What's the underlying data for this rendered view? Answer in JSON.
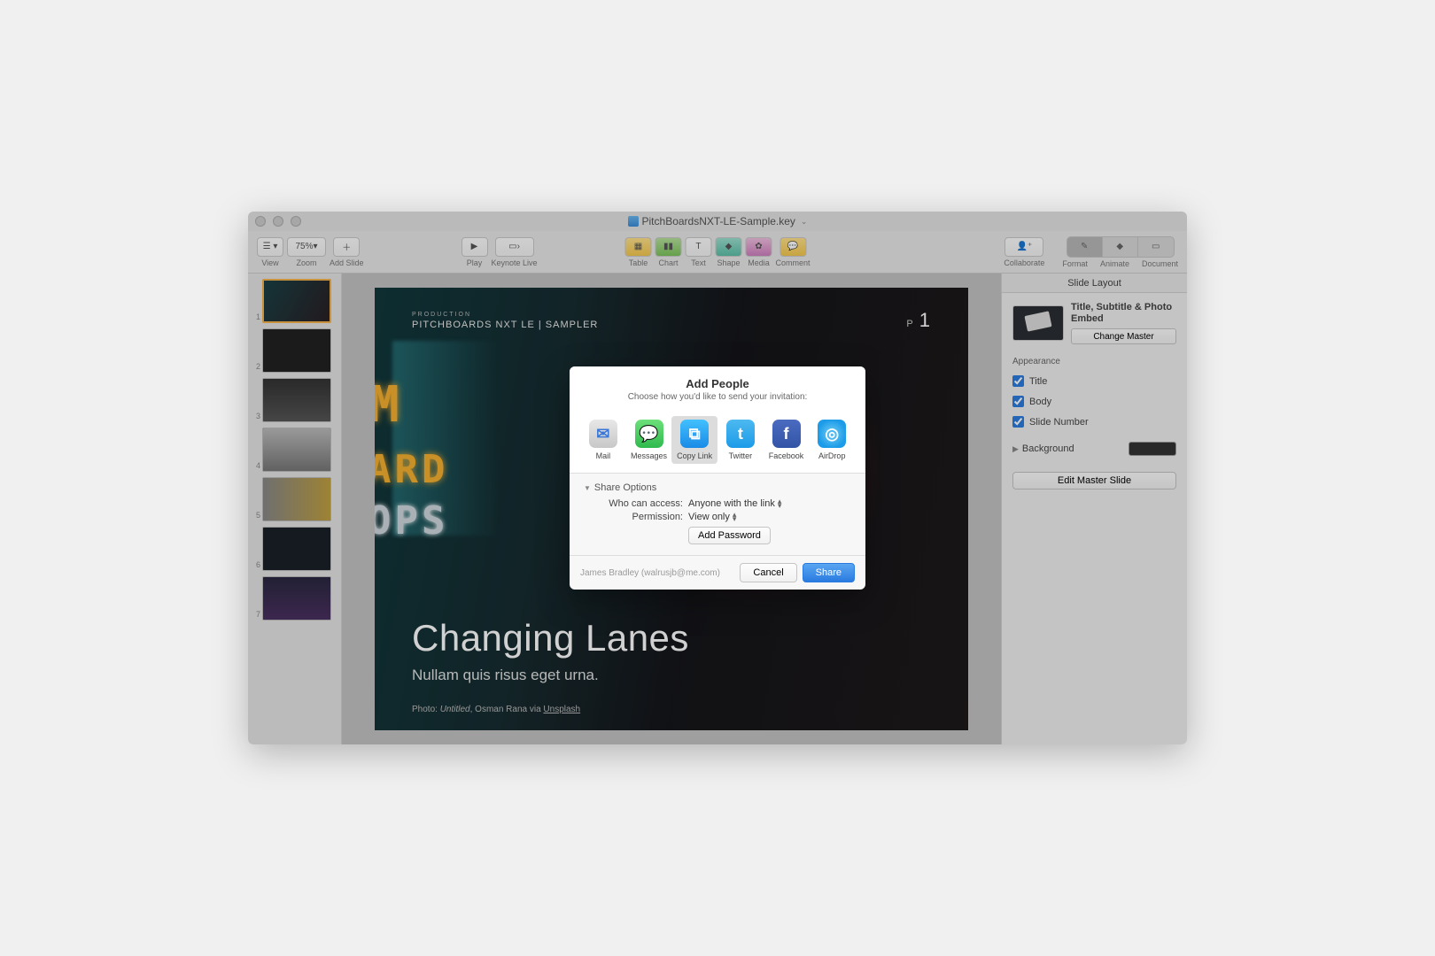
{
  "titlebar": {
    "filename": "PitchBoardsNXT-LE-Sample.key"
  },
  "toolbar": {
    "view": "View",
    "zoom": "Zoom",
    "zoom_value": "75%",
    "add_slide": "Add Slide",
    "play": "Play",
    "keynote_live": "Keynote Live",
    "table": "Table",
    "chart": "Chart",
    "text": "Text",
    "shape": "Shape",
    "media": "Media",
    "comment": "Comment",
    "collaborate": "Collaborate",
    "format": "Format",
    "animate": "Animate",
    "document": "Document"
  },
  "navigator": {
    "slides": [
      {
        "num": "1"
      },
      {
        "num": "2"
      },
      {
        "num": "3"
      },
      {
        "num": "4"
      },
      {
        "num": "5"
      },
      {
        "num": "6"
      },
      {
        "num": "7"
      }
    ]
  },
  "slide": {
    "pre": "PRODUCTION",
    "header": "PITCHBOARDS NXT LE | SAMPLER",
    "page_prefix": "P",
    "page_num": "1",
    "neon1": "M",
    "neon2": "ARD",
    "neon3": "OPS",
    "title": "Changing Lanes",
    "subtitle": "Nullam quis risus eget urna.",
    "credit_label": "Photo:",
    "credit_title": "Untitled",
    "credit_author": ", Osman Rana via ",
    "credit_link": "Unsplash"
  },
  "inspector": {
    "header": "Slide Layout",
    "layout_name": "Title, Subtitle & Photo Embed",
    "change_master": "Change Master",
    "appearance_label": "Appearance",
    "cb_title": "Title",
    "cb_body": "Body",
    "cb_slidenum": "Slide Number",
    "background_label": "Background",
    "edit_master": "Edit Master Slide"
  },
  "dialog": {
    "title": "Add People",
    "subtitle": "Choose how you'd like to send your invitation:",
    "options": {
      "mail": "Mail",
      "messages": "Messages",
      "copylink": "Copy Link",
      "twitter": "Twitter",
      "facebook": "Facebook",
      "airdrop": "AirDrop"
    },
    "share_options": "Share Options",
    "access_label": "Who can access:",
    "access_value": "Anyone with the link",
    "permission_label": "Permission:",
    "permission_value": "View only",
    "add_password": "Add Password",
    "user": "James Bradley (walrusjb@me.com)",
    "cancel": "Cancel",
    "share": "Share"
  }
}
